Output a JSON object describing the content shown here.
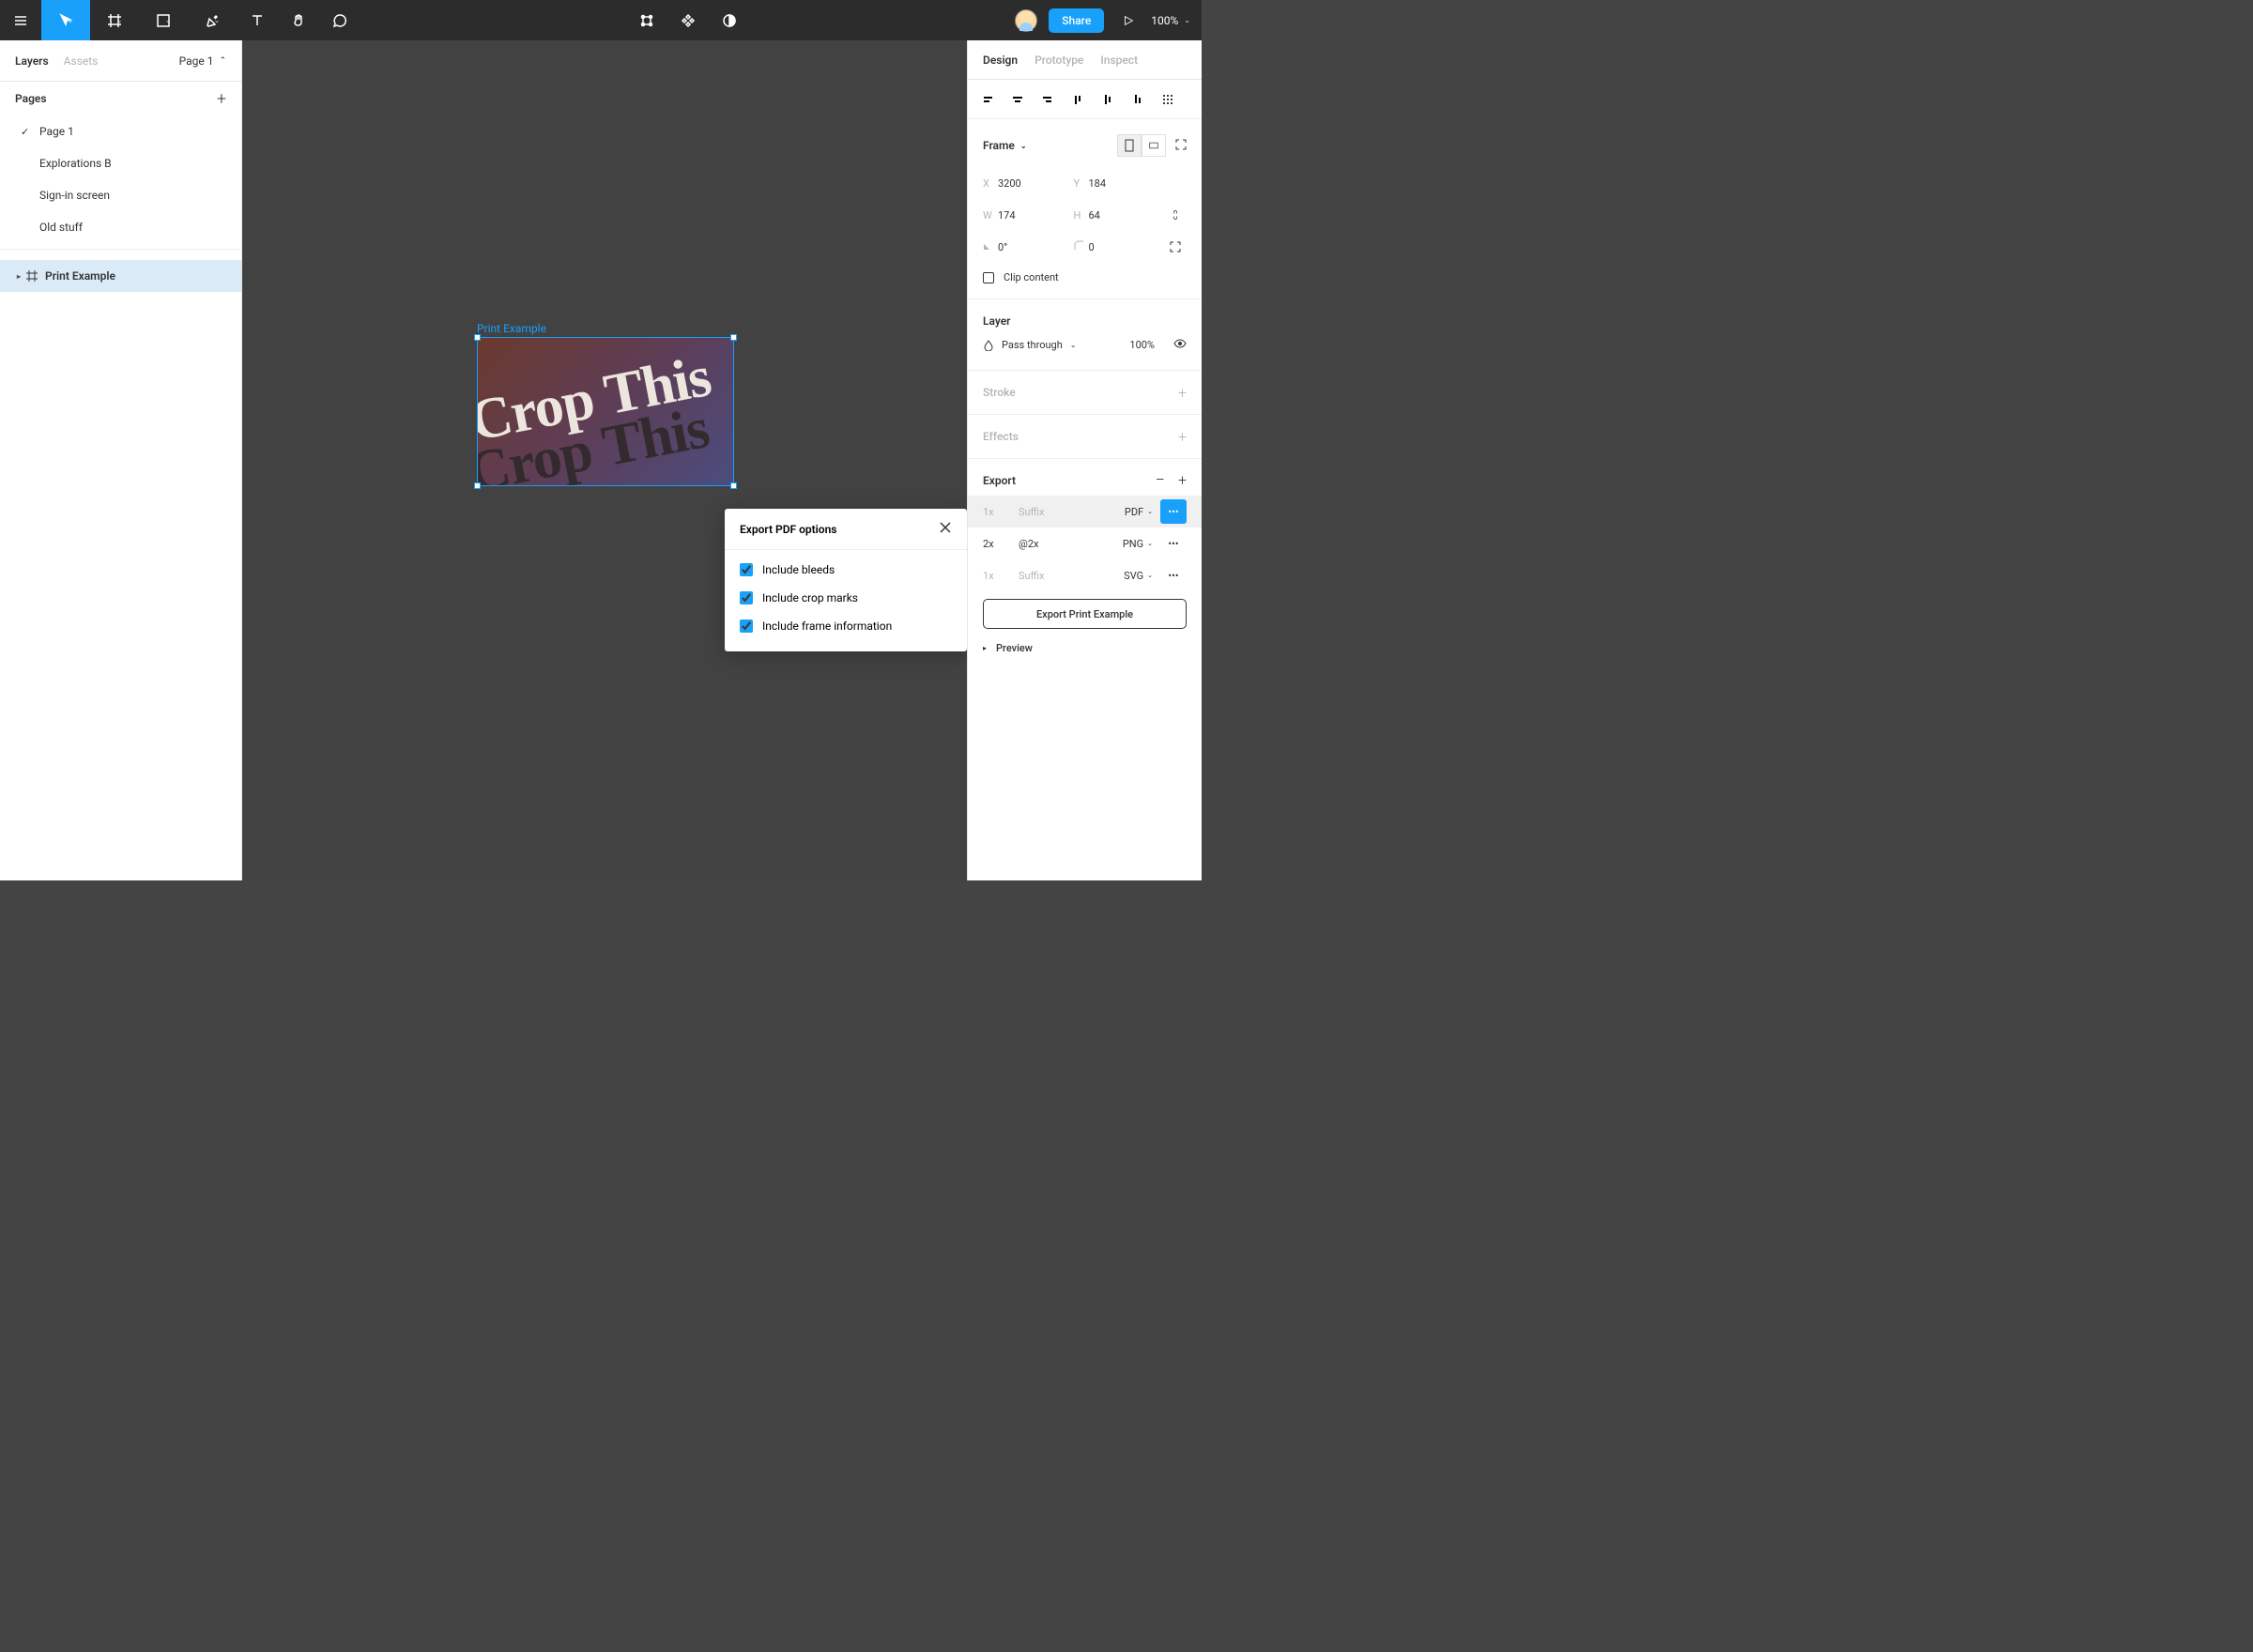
{
  "toolbar": {
    "share": "Share",
    "zoom": "100%"
  },
  "leftPanel": {
    "tabs": {
      "layers": "Layers",
      "assets": "Assets"
    },
    "currentPage": "Page 1",
    "pagesTitle": "Pages",
    "pages": [
      "Page 1",
      "Explorations B",
      "Sign-in screen",
      "Old stuff"
    ],
    "selectedLayer": "Print Example"
  },
  "canvas": {
    "frameLabel": "Print Example",
    "contentText": "Crop This"
  },
  "modal": {
    "title": "Export PDF options",
    "options": [
      "Include bleeds",
      "Include crop marks",
      "Include frame information"
    ]
  },
  "rightPanel": {
    "tabs": {
      "design": "Design",
      "prototype": "Prototype",
      "inspect": "Inspect"
    },
    "frame": {
      "title": "Frame",
      "x": "3200",
      "y": "184",
      "w": "174",
      "h": "64",
      "rotation": "0°",
      "radius": "0",
      "clipContent": "Clip content"
    },
    "layer": {
      "title": "Layer",
      "blend": "Pass through",
      "opacity": "100%"
    },
    "stroke": "Stroke",
    "effects": "Effects",
    "export": {
      "title": "Export",
      "rows": [
        {
          "scale": "1x",
          "suffix": "Suffix",
          "suffixMuted": true,
          "format": "PDF",
          "scaleMuted": true,
          "selected": true,
          "dotsSelected": true
        },
        {
          "scale": "2x",
          "suffix": "@2x",
          "suffixMuted": false,
          "format": "PNG",
          "scaleMuted": false,
          "selected": false,
          "dotsSelected": false
        },
        {
          "scale": "1x",
          "suffix": "Suffix",
          "suffixMuted": true,
          "format": "SVG",
          "scaleMuted": true,
          "selected": false,
          "dotsSelected": false
        }
      ],
      "button": "Export Print Example",
      "preview": "Preview"
    }
  }
}
